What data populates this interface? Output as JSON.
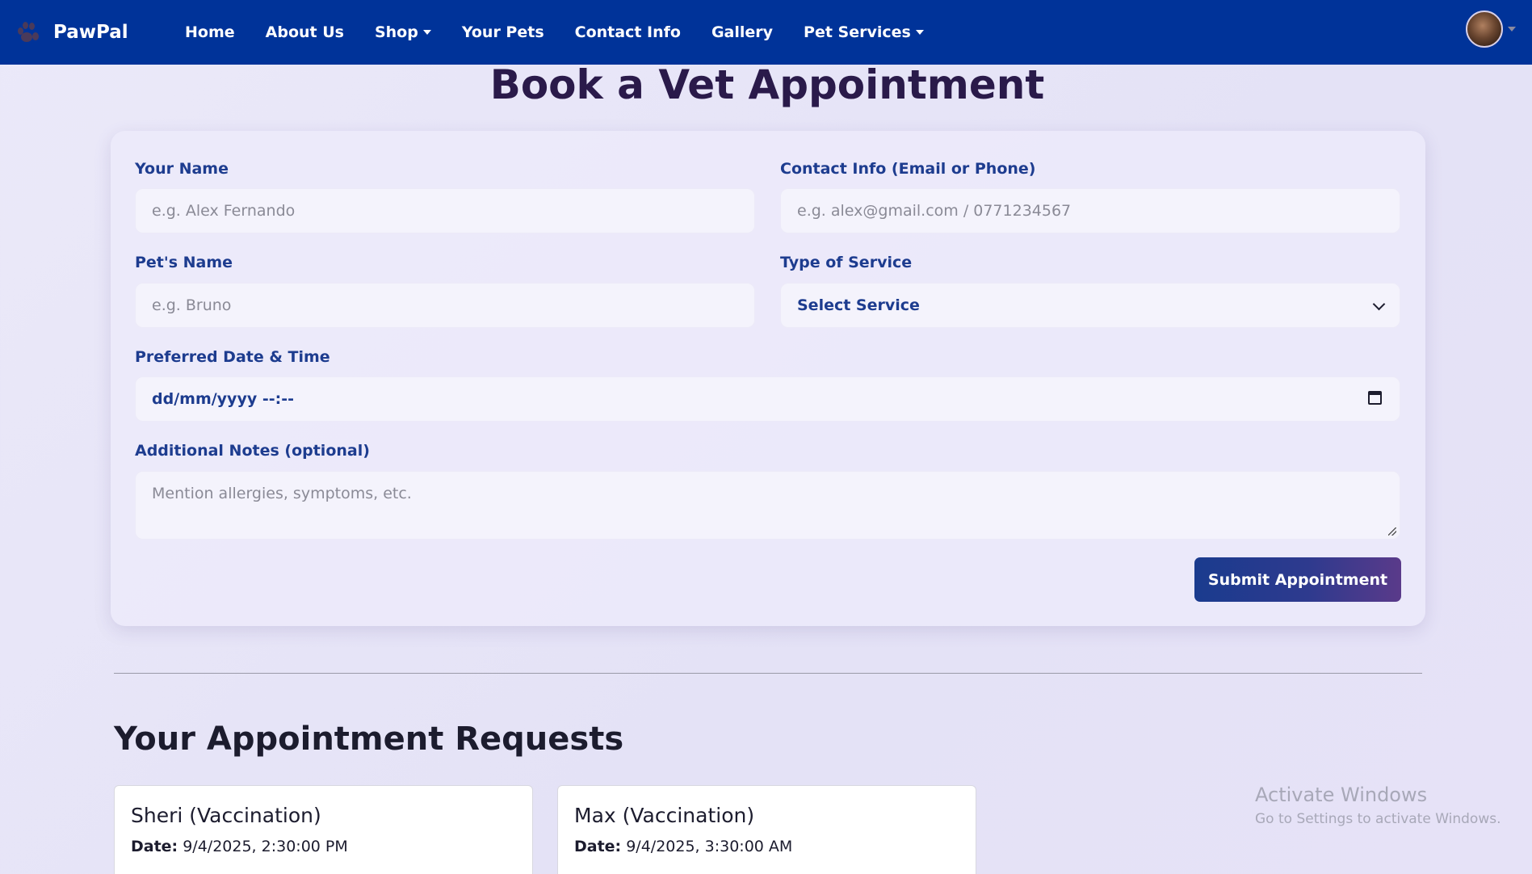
{
  "nav": {
    "brand": "PawPal",
    "items": [
      {
        "label": "Home",
        "dropdown": false
      },
      {
        "label": "About Us",
        "dropdown": false
      },
      {
        "label": "Shop",
        "dropdown": true
      },
      {
        "label": "Your Pets",
        "dropdown": false
      },
      {
        "label": "Contact Info",
        "dropdown": false
      },
      {
        "label": "Gallery",
        "dropdown": false
      },
      {
        "label": "Pet Services",
        "dropdown": true
      }
    ]
  },
  "page": {
    "title": "Book a Vet Appointment"
  },
  "form": {
    "name_label": "Your Name",
    "name_placeholder": "e.g. Alex Fernando",
    "contact_label": "Contact Info (Email or Phone)",
    "contact_placeholder": "e.g. alex@gmail.com / 0771234567",
    "pet_label": "Pet's Name",
    "pet_placeholder": "e.g. Bruno",
    "service_label": "Type of Service",
    "service_selected": "Select Service",
    "datetime_label": "Preferred Date & Time",
    "datetime_value": "dd/mm/yyyy --:--",
    "notes_label": "Additional Notes (optional)",
    "notes_placeholder": "Mention allergies, symptoms, etc.",
    "submit_label": "Submit Appointment"
  },
  "requests": {
    "title": "Your Appointment Requests",
    "date_label": "Date:",
    "items": [
      {
        "title": "Sheri (Vaccination)",
        "date": "9/4/2025, 2:30:00 PM"
      },
      {
        "title": "Max (Vaccination)",
        "date": "9/4/2025, 3:30:00 AM"
      }
    ]
  },
  "watermark": {
    "line1": "Activate Windows",
    "line2": "Go to Settings to activate Windows."
  },
  "colors": {
    "navbar": "#003399",
    "label": "#1d3c8f",
    "title": "#2a1a4a"
  }
}
